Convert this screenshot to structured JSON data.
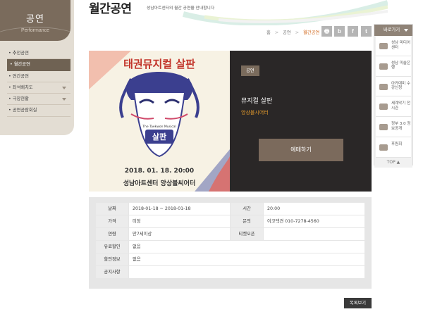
{
  "sidebar": {
    "title": "공연",
    "subtitle": "Performance",
    "items": [
      {
        "label": "• 추천공연"
      },
      {
        "label": "• 월간공연"
      },
      {
        "label": "• 연간공연"
      },
      {
        "label": "• 좌석배치도"
      },
      {
        "label": "• 극장현황"
      },
      {
        "label": "• 공연공람회실"
      }
    ]
  },
  "header": {
    "title": "월간공연",
    "description": "성남아트센터의 월간 공연을 안내합니다"
  },
  "breadcrumb": {
    "home": "홈",
    "level1": "공연",
    "current": "월간공연",
    "separator": ">"
  },
  "share": {
    "print": "🖶",
    "blog": "b",
    "facebook": "f",
    "twitter": "t"
  },
  "poster": {
    "title": "태권뮤지컬 살판",
    "tagline": "The Taekwon Musical",
    "inner_title": "살판",
    "date": "2018. 01. 18. 20:00",
    "venue": "성남아트센터 앙상블씨어터"
  },
  "show": {
    "genre": "공연",
    "title": "뮤지컬 살판",
    "venue": "앙상블시어터",
    "book_label": "예매하기"
  },
  "details": {
    "date_label": "날짜",
    "date_value": "2018-01-18 ~ 2018-01-18",
    "time_label": "시간",
    "time_value": "20:00",
    "price_label": "가격",
    "price_value": "미정",
    "contact_label": "문의",
    "contact_value": "이코택견 010-7278-4560",
    "age_label": "연령",
    "age_value": "만7세이상",
    "ticket_label": "티켓오픈",
    "ticket_value": "",
    "paid_discount_label": "유료할인",
    "paid_discount_value": "없음",
    "discount_label": "할인정보",
    "discount_value": "없음",
    "notice_label": "공지사항",
    "notice_value": ""
  },
  "list_button": "목록보기",
  "quick_menu": {
    "title": "바로가기",
    "items": [
      {
        "label": "성남 미디어센터"
      },
      {
        "label": "성남 미술은행"
      },
      {
        "label": "아카데미 수강신청"
      },
      {
        "label": "세계악기 전시관"
      },
      {
        "label": "정부 3.0 정보공개"
      },
      {
        "label": "후원회"
      }
    ],
    "top_label": "TOP ▲"
  },
  "colors": {
    "accent_brown": "#7a6b5c",
    "venue_orange": "#e39a2c",
    "breadcrumb_current": "#d2691e",
    "dark_panel": "#2a2727"
  }
}
